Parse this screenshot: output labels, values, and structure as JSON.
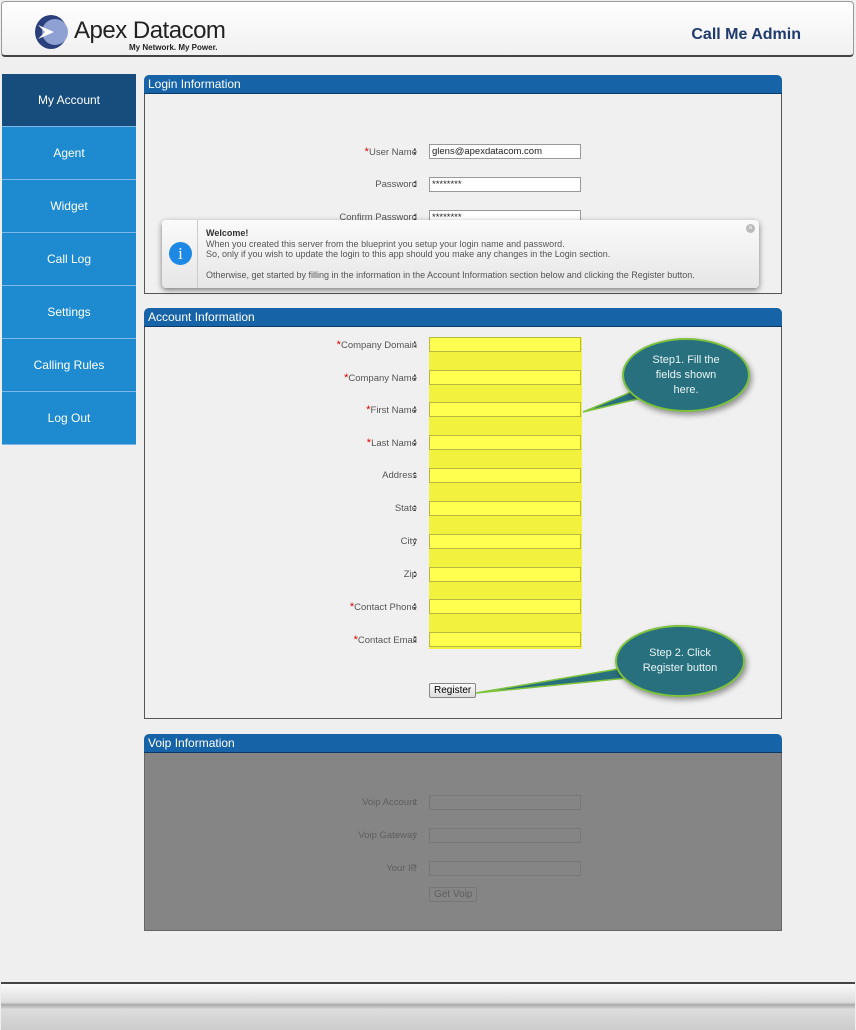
{
  "header": {
    "brand": "Apex Datacom",
    "tagline": "My Network. My Power.",
    "app_title": "Call Me Admin"
  },
  "sidebar": {
    "items": [
      {
        "label": "My Account",
        "active": true
      },
      {
        "label": "Agent"
      },
      {
        "label": "Widget"
      },
      {
        "label": "Call Log"
      },
      {
        "label": "Settings"
      },
      {
        "label": "Calling Rules"
      },
      {
        "label": "Log Out"
      }
    ]
  },
  "login": {
    "title": "Login Information",
    "fields": [
      {
        "label": "User Name",
        "required": true,
        "value": "glens@apexdatacom.com"
      },
      {
        "label": "Password",
        "value": "********"
      },
      {
        "label": "Confirm Password",
        "value": "********"
      }
    ]
  },
  "toast": {
    "title": "Welcome!",
    "line1": "When you created this server from the blueprint you setup your login name and password.",
    "line2": "So, only if you wish to update the login to this app should you make any changes in the Login section.",
    "line3": "Otherwise, get started by filling in the information in the Account Information section below and clicking the Register button."
  },
  "account": {
    "title": "Account Information",
    "fields": [
      {
        "label": "Company Domain",
        "required": true
      },
      {
        "label": "Company Name",
        "required": true
      },
      {
        "label": "First Name",
        "required": true
      },
      {
        "label": "Last Name",
        "required": true
      },
      {
        "label": "Address"
      },
      {
        "label": "State"
      },
      {
        "label": "City"
      },
      {
        "label": "Zip"
      },
      {
        "label": "Contact Phone",
        "required": true
      },
      {
        "label": "Contact Email",
        "required": true
      }
    ],
    "register_label": "Register",
    "highlight_color": "#ffff50"
  },
  "callouts": {
    "step1": "Step1. Fill the fields shown here.",
    "step2": "Step 2. Click Register button"
  },
  "voip": {
    "title": "Voip Information",
    "fields": [
      {
        "label": "Voip Account"
      },
      {
        "label": "Voip Gateway"
      },
      {
        "label": "Your IP"
      }
    ],
    "button_label": "Get Voip"
  },
  "colors": {
    "nav": "#1e8bd0",
    "nav_active": "#164d7c",
    "panel_header": "#1763a8"
  }
}
